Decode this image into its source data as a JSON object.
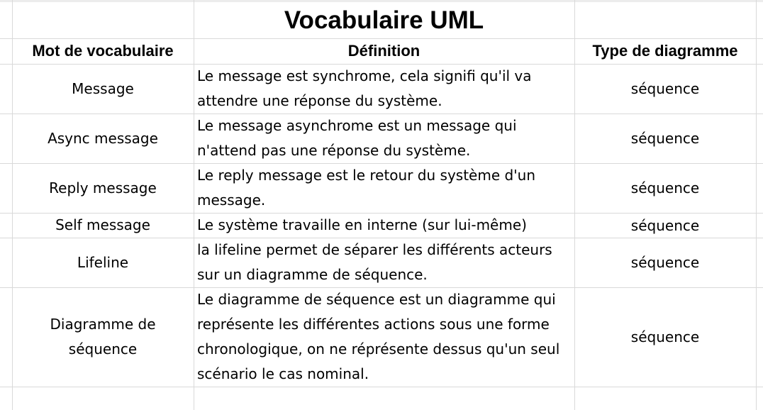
{
  "title": "Vocabulaire UML",
  "headers": {
    "term": "Mot de vocabulaire",
    "definition": "Définition",
    "type": "Type de diagramme"
  },
  "rows": [
    {
      "term": "Message",
      "definition": "Le message est synchrome, cela signifi qu'il va attendre une réponse du système.",
      "type": "séquence"
    },
    {
      "term": "Async message",
      "definition": "Le message asynchrome est un message qui n'attend pas une réponse du système.",
      "type": "séquence"
    },
    {
      "term": "Reply message",
      "definition": "Le reply message est le retour du système d'un message.",
      "type": "séquence"
    },
    {
      "term": "Self message",
      "definition": "Le système travaille en interne (sur lui-même)",
      "type": "séquence"
    },
    {
      "term": "Lifeline",
      "definition": "la lifeline permet de séparer les différents acteurs sur un diagramme de séquence.",
      "type": "séquence"
    },
    {
      "term": "Diagramme de séquence",
      "definition": "Le diagramme de séquence est un diagramme qui représente les différentes actions sous une forme chronologique, on ne réprésente dessus qu'un seul scénario le cas nominal.",
      "type": "séquence"
    }
  ]
}
